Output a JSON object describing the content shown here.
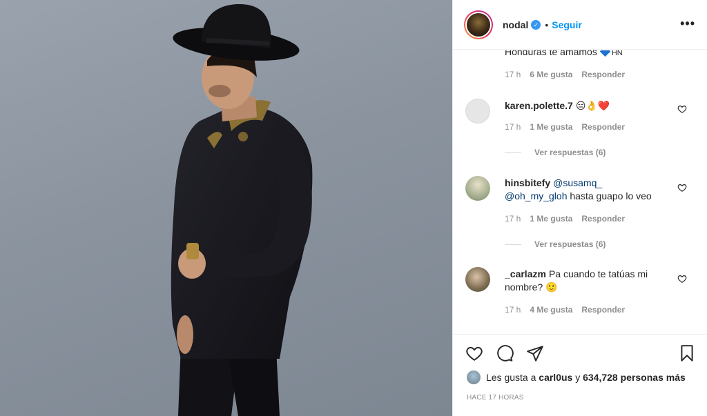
{
  "post": {
    "username": "nodal",
    "follow_label": "Seguir",
    "separator": "•",
    "more_label": "•••"
  },
  "comments": {
    "partial_text": "Honduras te amamos",
    "partial_flag_text": "HN",
    "partial_meta": {
      "time": "17 h",
      "likes": "6 Me gusta",
      "reply": "Responder"
    },
    "items": [
      {
        "user": "karen.polette.7",
        "text": "😑👌❤️",
        "time": "17 h",
        "likes": "1 Me gusta",
        "reply": "Responder",
        "view_replies": "Ver respuestas (6)"
      },
      {
        "user": "hinsbitefy",
        "mention1": "@susamq_",
        "mention2": "@oh_my_gloh",
        "text": "hasta guapo lo veo",
        "time": "17 h",
        "likes": "1 Me gusta",
        "reply": "Responder",
        "view_replies": "Ver respuestas (6)"
      },
      {
        "user": "_carlazm",
        "text": "Pa cuando te tatúas mi nombre? 🙂",
        "time": "17 h",
        "likes": "4 Me gusta",
        "reply": "Responder"
      }
    ]
  },
  "likes_summary": {
    "prefix": "Les gusta a",
    "user": "carl0us",
    "connector": "y",
    "count": "634,728 personas más"
  },
  "time_ago": "HACE 17 HORAS",
  "colors": {
    "accent": "#0095f6",
    "verified": "#3897f0",
    "muted": "#8e8e8e",
    "text": "#262626"
  },
  "icons": [
    "heart-icon",
    "comment-icon",
    "share-icon",
    "save-icon",
    "verified-icon",
    "more-icon"
  ]
}
